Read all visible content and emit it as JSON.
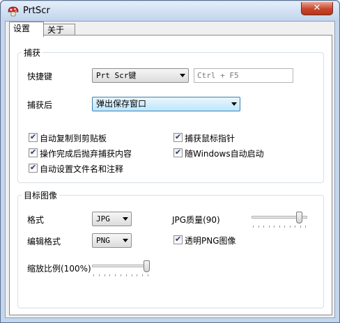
{
  "window": {
    "title": "PrtScr",
    "close_symbol": "✕"
  },
  "tabs": [
    {
      "label": "设置",
      "active": true
    },
    {
      "label": "关于",
      "active": false
    }
  ],
  "capture": {
    "group_title": "捕获",
    "hotkey_label": "快捷键",
    "hotkey_value": "Prt Scr键",
    "hotkey_display": "Ctrl + F5",
    "after_label": "捕获后",
    "after_value": "弹出保存窗口",
    "checkboxes": [
      {
        "label": "自动复制到剪贴板",
        "checked": true
      },
      {
        "label": "捕获鼠标指针",
        "checked": true
      },
      {
        "label": "操作完成后抛弃捕获内容",
        "checked": true
      },
      {
        "label": "随Windows自动启动",
        "checked": true
      },
      {
        "label": "自动设置文件名和注释",
        "checked": true
      }
    ]
  },
  "target": {
    "group_title": "目标图像",
    "format_label": "格式",
    "format_value": "JPG",
    "jpg_quality_label": "JPG质量(90)",
    "jpg_quality": 90,
    "edit_format_label": "编辑格式",
    "edit_format_value": "PNG",
    "transparent_png_label": "透明PNG图像",
    "transparent_png_checked": true,
    "scale_label": "缩放比例(100%)",
    "scale_percent": 100
  },
  "colors": {
    "accent_combo": "#bee6fd",
    "close_button": "#c7452c",
    "check_mark": "#2a3a6c"
  },
  "icons": {
    "app": "prtscr-mushroom-icon",
    "check": "✔"
  }
}
